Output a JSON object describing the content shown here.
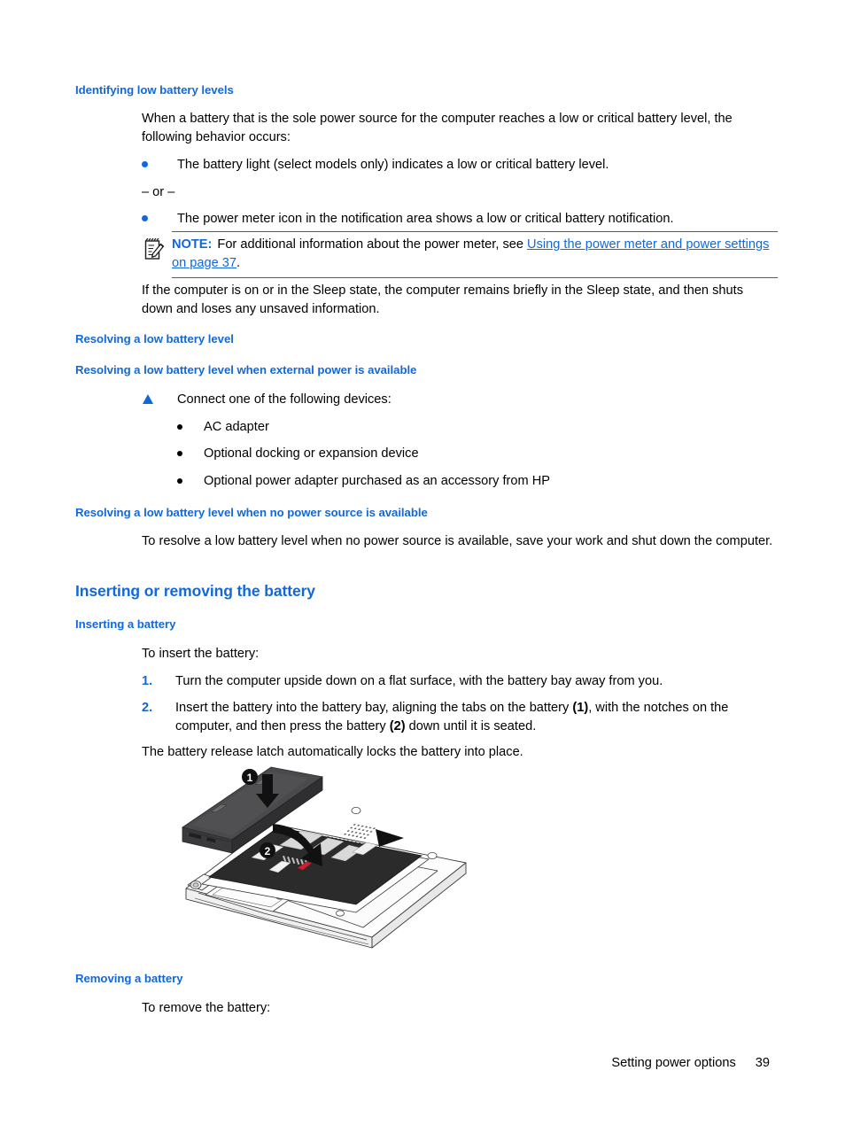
{
  "document": {
    "accent_color": "#1268DB",
    "text_color": "#000000",
    "background": "#ffffff"
  },
  "sections": {
    "identifying_heading": "Identifying low battery levels",
    "intro_paragraph": "When a battery that is the sole power source for the computer reaches a low or critical battery level, the following behavior occurs:",
    "bullet_battery_light": "The battery light (select models only) indicates a low or critical battery level.",
    "or_separator": "– or –",
    "bullet_power_meter": "The power meter icon in the notification area shows a low or critical battery notification.",
    "sleep_paragraph": "If the computer is on or in the Sleep state, the computer remains briefly in the Sleep state, and then shuts down and loses any unsaved information.",
    "resolving_heading": "Resolving a low battery level",
    "resolving_external_heading": "Resolving a low battery level when external power is available",
    "connect_devices": "Connect one of the following devices:",
    "device_options": [
      "AC adapter",
      "Optional docking or expansion device",
      "Optional power adapter purchased as an accessory from HP"
    ],
    "resolving_no_power_heading": "Resolving a low battery level when no power source is available",
    "resolving_no_power_paragraph": "To resolve a low battery level when no power source is available, save your work and shut down the computer.",
    "inserting_removing_heading": "Inserting or removing the battery",
    "inserting_heading": "Inserting a battery",
    "to_insert_lead": "To insert the battery:",
    "steps": [
      {
        "number": "1.",
        "text_parts": [
          {
            "text": "Turn the computer upside down on a flat surface, with the battery bay away from you.",
            "bold": false
          }
        ]
      },
      {
        "number": "2.",
        "text_parts": [
          {
            "text": "Insert the battery into the battery bay, aligning the tabs on the battery ",
            "bold": false
          },
          {
            "text": "(1)",
            "bold": true
          },
          {
            "text": ", with the notches on the computer, and then press the battery ",
            "bold": false
          },
          {
            "text": "(2)",
            "bold": true
          },
          {
            "text": " down until it is seated.",
            "bold": false
          }
        ]
      }
    ],
    "latch_paragraph": "The battery release latch automatically locks the battery into place.",
    "removing_heading": "Removing a battery",
    "to_remove_lead": "To remove the battery:"
  },
  "note": {
    "label": "NOTE:",
    "text_before": "For additional information about the power meter, see ",
    "link_text": "Using the power meter and power settings on page 37",
    "text_after": ".",
    "icon": "note-clipboard-pencil-icon"
  },
  "figure": {
    "alt": "Illustration of inserting a battery into the laptop battery bay",
    "callouts": [
      {
        "label": "1",
        "meaning": "align tabs on the battery"
      },
      {
        "label": "2",
        "meaning": "press the battery down"
      }
    ]
  },
  "footer": {
    "section_title": "Setting power options",
    "page_number": "39"
  }
}
